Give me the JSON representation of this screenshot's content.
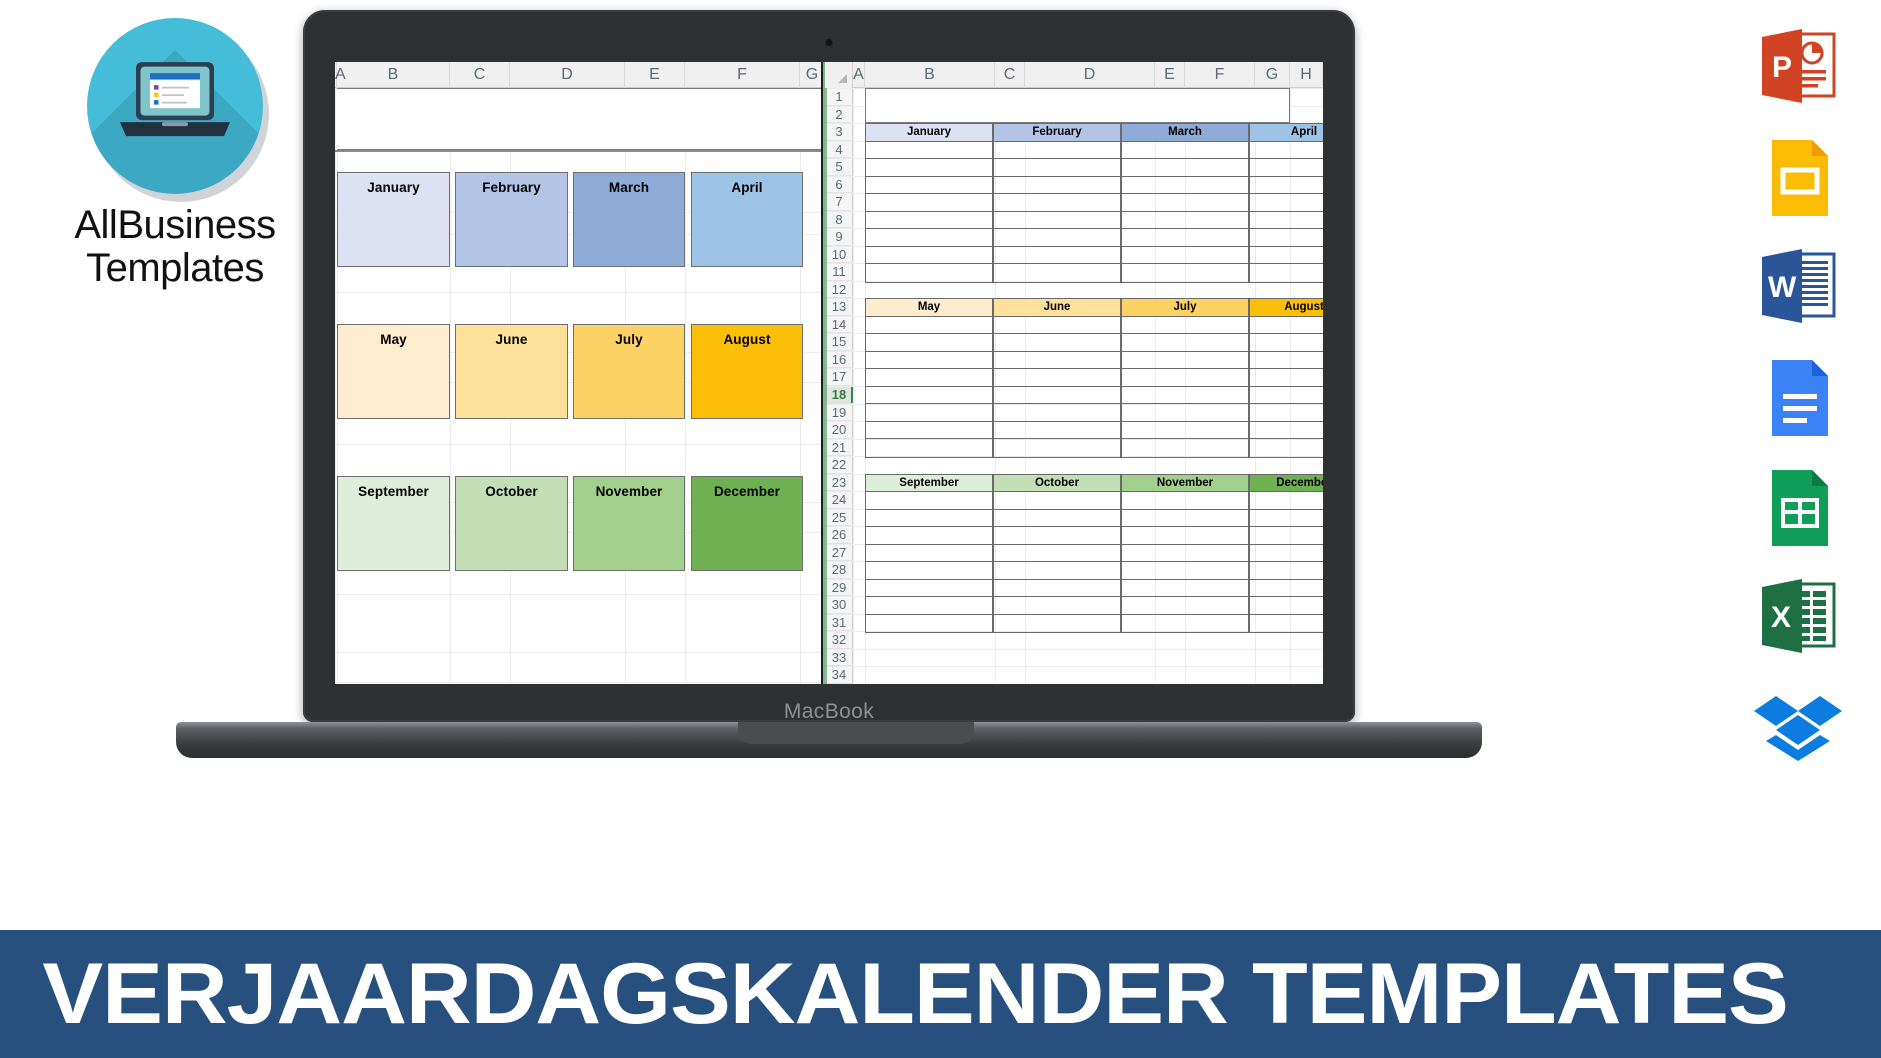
{
  "brand": {
    "name_line1": "AllBusiness",
    "name_line2": "Templates",
    "logo_icon": "laptop-in-circle-icon",
    "accent_color": "#45bcd8"
  },
  "device": {
    "label": "MacBook",
    "type": "macbook-laptop"
  },
  "banner": {
    "text": "VERJAARDAGSKALENDER TEMPLATES",
    "background_color": "#27507f",
    "text_color": "#ffffff"
  },
  "left_sheet": {
    "column_headers": [
      "A",
      "B",
      "C",
      "D",
      "E",
      "F",
      "G"
    ],
    "month_cards": [
      {
        "label": "January",
        "fill": "#dce2f2",
        "row": 0,
        "col": 0
      },
      {
        "label": "February",
        "fill": "#b2c5e6",
        "row": 0,
        "col": 1
      },
      {
        "label": "March",
        "fill": "#8facd9",
        "row": 0,
        "col": 2
      },
      {
        "label": "April",
        "fill": "#9dc3e6",
        "row": 0,
        "col": 3
      },
      {
        "label": "May",
        "fill": "#fdeccd",
        "row": 1,
        "col": 0
      },
      {
        "label": "June",
        "fill": "#fde09a",
        "row": 1,
        "col": 1
      },
      {
        "label": "July",
        "fill": "#fcd265",
        "row": 1,
        "col": 2
      },
      {
        "label": "August",
        "fill": "#fcbf07",
        "row": 1,
        "col": 3
      },
      {
        "label": "September",
        "fill": "#dfeedb",
        "row": 2,
        "col": 0
      },
      {
        "label": "October",
        "fill": "#c3dfb5",
        "row": 2,
        "col": 1
      },
      {
        "label": "November",
        "fill": "#a3cf8c",
        "row": 2,
        "col": 2
      },
      {
        "label": "December",
        "fill": "#6fb052",
        "row": 2,
        "col": 3
      }
    ]
  },
  "right_sheet": {
    "column_headers": [
      "A",
      "B",
      "C",
      "D",
      "E",
      "F",
      "G",
      "H"
    ],
    "row_numbers": [
      "1",
      "2",
      "3",
      "4",
      "5",
      "6",
      "7",
      "8",
      "9",
      "10",
      "11",
      "12",
      "13",
      "14",
      "15",
      "16",
      "17",
      "18",
      "19",
      "20",
      "21",
      "22",
      "23",
      "24",
      "25",
      "26",
      "27",
      "28",
      "29",
      "30",
      "31",
      "32",
      "33",
      "34"
    ],
    "active_row": "18",
    "selection_color": "#2f8a4a",
    "month_tables": [
      {
        "label": "January",
        "fill": "#dce2f2",
        "header_row": "3",
        "entry_rows": 8,
        "block": 0,
        "col": 0
      },
      {
        "label": "February",
        "fill": "#b2c5e6",
        "header_row": "3",
        "entry_rows": 8,
        "block": 0,
        "col": 1
      },
      {
        "label": "March",
        "fill": "#8facd9",
        "header_row": "3",
        "entry_rows": 8,
        "block": 0,
        "col": 2
      },
      {
        "label": "April",
        "fill": "#9dc3e6",
        "header_row": "3",
        "entry_rows": 8,
        "block": 0,
        "col": 3
      },
      {
        "label": "May",
        "fill": "#fdeccd",
        "header_row": "13",
        "entry_rows": 8,
        "block": 1,
        "col": 0
      },
      {
        "label": "June",
        "fill": "#fde09a",
        "header_row": "13",
        "entry_rows": 8,
        "block": 1,
        "col": 1
      },
      {
        "label": "July",
        "fill": "#fcd265",
        "header_row": "13",
        "entry_rows": 8,
        "block": 1,
        "col": 2
      },
      {
        "label": "August",
        "fill": "#fcbf07",
        "header_row": "13",
        "entry_rows": 8,
        "block": 1,
        "col": 3
      },
      {
        "label": "September",
        "fill": "#dfeedb",
        "header_row": "23",
        "entry_rows": 8,
        "block": 2,
        "col": 0
      },
      {
        "label": "October",
        "fill": "#c3dfb5",
        "header_row": "23",
        "entry_rows": 8,
        "block": 2,
        "col": 1
      },
      {
        "label": "November",
        "fill": "#a3cf8c",
        "header_row": "23",
        "entry_rows": 8,
        "block": 2,
        "col": 2
      },
      {
        "label": "December",
        "fill": "#6fb052",
        "header_row": "23",
        "entry_rows": 8,
        "block": 2,
        "col": 3
      }
    ]
  },
  "icon_rail": [
    {
      "name": "powerpoint-icon",
      "label": "P",
      "color": "#d04423"
    },
    {
      "name": "google-slides-icon",
      "label": "",
      "color": "#fbbc04"
    },
    {
      "name": "word-icon",
      "label": "W",
      "color": "#2a5699"
    },
    {
      "name": "google-docs-icon",
      "label": "",
      "color": "#3b82f6"
    },
    {
      "name": "google-sheets-icon",
      "label": "",
      "color": "#0f9d58"
    },
    {
      "name": "excel-icon",
      "label": "X",
      "color": "#1e6f43"
    },
    {
      "name": "dropbox-icon",
      "label": "",
      "color": "#0d7ce0"
    }
  ]
}
